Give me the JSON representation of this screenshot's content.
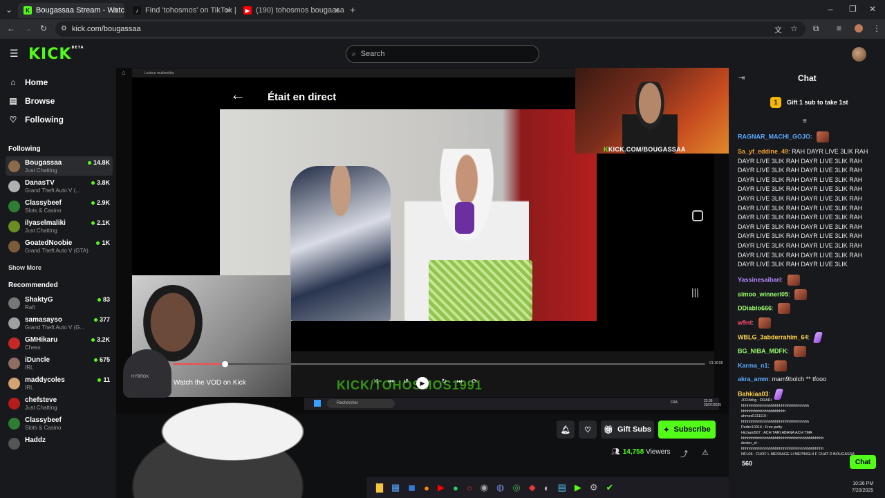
{
  "browser": {
    "tabs": [
      {
        "label": "Bougassaa Stream - Watch Live",
        "favicon_color": "#53fc18",
        "favicon_text": "K"
      },
      {
        "label": "Find 'tohosmos' on TikTok | Tik",
        "favicon_color": "#111111",
        "favicon_text": "♪"
      },
      {
        "label": "(190) tohosmos bougaasa - Yo",
        "favicon_color": "#ff0000",
        "favicon_text": "▶"
      }
    ],
    "new_tab": "+",
    "url": "kick.com/bougassaa",
    "window_controls": [
      "–",
      "❐",
      "✕"
    ]
  },
  "kick": {
    "logo": "KICK",
    "logo_badge": "BETA",
    "search_placeholder": "Search",
    "brand_color": "#53fc18"
  },
  "sidebar": {
    "nav": [
      {
        "label": "Home",
        "icon": "home-icon"
      },
      {
        "label": "Browse",
        "icon": "browse-icon"
      },
      {
        "label": "Following",
        "icon": "heart-icon"
      }
    ],
    "following_header": "Following",
    "following": [
      {
        "name": "Bougassaa",
        "category": "Just Chatting",
        "viewers": "14.8K",
        "color": "#8a6a4a"
      },
      {
        "name": "DanasTV",
        "category": "Grand Theft Auto V (...",
        "viewers": "3.8K",
        "color": "#b0b0b0"
      },
      {
        "name": "Classybeef",
        "category": "Slots & Casino",
        "viewers": "2.9K",
        "color": "#2e7d32"
      },
      {
        "name": "ilyaselmaliki",
        "category": "Just Chatting",
        "viewers": "2.1K",
        "color": "#6b8e23"
      },
      {
        "name": "GoatedNoobie",
        "category": "Grand Theft Auto V (GTA)",
        "viewers": "1K",
        "color": "#7a5c3a"
      }
    ],
    "show_more": "Show More",
    "recommended_header": "Recommended",
    "recommended": [
      {
        "name": "ShaktyG",
        "category": "Raft",
        "viewers": "83",
        "color": "#777777"
      },
      {
        "name": "samasayso",
        "category": "Grand Theft Auto V (G...",
        "viewers": "377",
        "color": "#a0a0a0"
      },
      {
        "name": "GMHikaru",
        "category": "Chess",
        "viewers": "3.2K",
        "color": "#c62828"
      },
      {
        "name": "iDuncle",
        "category": "IRL",
        "viewers": "675",
        "color": "#8d6e63"
      },
      {
        "name": "maddycoles",
        "category": "IRL",
        "viewers": "11",
        "color": "#d4a373"
      },
      {
        "name": "chefsteve",
        "category": "Just Chatting",
        "viewers": "",
        "color": "#b71c1c"
      },
      {
        "name": "Classybeef",
        "category": "Slots & Casino",
        "viewers": "",
        "color": "#2e7d32"
      },
      {
        "name": "Haddz",
        "category": "",
        "viewers": "",
        "color": "#555555"
      }
    ]
  },
  "player": {
    "media_player_label": "Lecteur multimédia",
    "was_live": "Était en direct",
    "cam_url": "KICK.COM/BOUGASSAA",
    "watch_vod": "Watch the VOD on Kick",
    "watermark": "KICK/TOHOSMOS1991",
    "timecode": "01:16:58",
    "progress": 0.1,
    "inner_search": "Rechercher",
    "inner_lang": "FRA",
    "inner_time": "22:36",
    "inner_date": "20/07/2025",
    "hybrok": "HYBROK"
  },
  "actions": {
    "gift_subs": "Gift Subs",
    "subscribe": "Subscribe",
    "viewers_count": "14,758",
    "viewers_label": "Viewers"
  },
  "chat": {
    "title": "Chat",
    "gift_banner": "Gift 1 sub to take 1st",
    "gift_rank": "1",
    "messages": [
      {
        "user": "RAGNAR_MACHI_GOJO",
        "color": "#5aa9ff",
        "text": "",
        "emote": "brown"
      },
      {
        "user": "Sa_yf_eddine_49",
        "color": "#f0a030",
        "text": "RAH DAYR LIVE 3LIK RAH DAYR LIVE 3LIK RAH DAYR LIVE 3LIK RAH DAYR LIVE 3LIK RAH DAYR LIVE 3LIK RAH DAYR LIVE 3LIK RAH DAYR LIVE 3LIK RAH DAYR LIVE 3LIK RAH DAYR LIVE 3LIK RAH DAYR LIVE 3LIK RAH DAYR LIVE 3LIK RAH DAYR LIVE 3LIK RAH DAYR LIVE 3LIK RAH DAYR LIVE 3LIK RAH DAYR LIVE 3LIK RAH DAYR LIVE 3LIK RAH DAYR LIVE 3LIK RAH DAYR LIVE 3LIK RAH DAYR LIVE 3LIK RAH DAYR LIVE 3LIK RAH DAYR LIVE 3LIK RAH DAYR LIVE 3LIK RAH DAYR LIVE 3LIK RAH DAYR LIVE 3LIK RAH DAYR LIVE 3LIK",
        "emote": ""
      },
      {
        "user": "Yassinesaibari",
        "color": "#b388ff",
        "text": "",
        "emote": "brown"
      },
      {
        "user": "simoo_winneri05",
        "color": "#9cff6e",
        "text": "",
        "emote": "brown"
      },
      {
        "user": "DDiablo666",
        "color": "#9cff6e",
        "text": "",
        "emote": "brown"
      },
      {
        "user": "w9nt",
        "color": "#ff4d6d",
        "text": "",
        "emote": "brown"
      },
      {
        "user": "WBLG_3abderrahim_64",
        "color": "#ffd54f",
        "text": "",
        "emote": "purple"
      },
      {
        "user": "BG_NIBA_MDFK",
        "color": "#9cff6e",
        "text": "",
        "emote": "brown"
      },
      {
        "user": "Karma_n1",
        "color": "#5aa9ff",
        "text": "",
        "emote": "brown"
      },
      {
        "user": "akra_amm",
        "color": "#5aa9ff",
        "text": "mam9bolch ** tfooo",
        "emote": ""
      },
      {
        "user": "Bahkiaa03",
        "color": "#ffd54f",
        "text": "",
        "emote": "purple"
      }
    ],
    "overlay_lines": [
      "JO24dhg : DRARI",
      "hhhhhhhhhhhhhhhhhhhhhhhhhhhhhhhh",
      "hhhhhhhhhhhhhhhhhhhhh",
      "ahmed1111110 :",
      "hhhhhhhhhhhhhhhhhhhhhhhhhhhhhhhh",
      "Pedro10014 : Free petty",
      "Hicham567 : ACH TARI ABANA ACH TMA",
      "hhhhhhhhhhhhhhhhhhhhhhhhhhhhhhhhhhhhhhh",
      "dexter_el :",
      "hhhhhhhhhhhhhhhhhhhhhhhhhhhhhhhhhhhhhhh",
      "NFL06 : CHOF L MESSAGE LI MEPINGLII F CHAT D BOUGASSA"
    ],
    "overlay_count": "560",
    "chat_button": "Chat",
    "system_time": "10:36 PM",
    "system_date": "7/20/2025"
  }
}
